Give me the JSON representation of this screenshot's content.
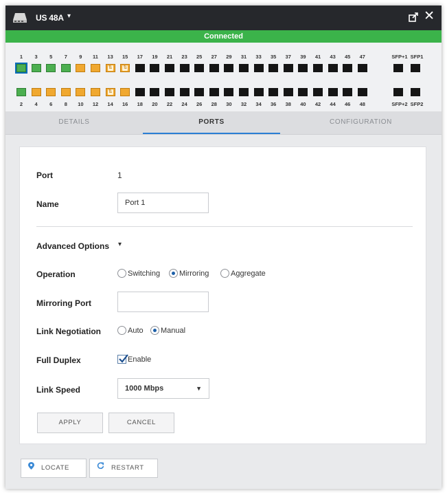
{
  "titlebar": {
    "device": "US 48A",
    "caret": "▾",
    "close": "✕"
  },
  "status": {
    "text": "Connected",
    "color": "#3bb34a"
  },
  "ports": {
    "top_labels": [
      "1",
      "3",
      "5",
      "7",
      "9",
      "11",
      "13",
      "15",
      "17",
      "19",
      "21",
      "23",
      "25",
      "27",
      "29",
      "31",
      "33",
      "35",
      "37",
      "39",
      "41",
      "43",
      "45",
      "47"
    ],
    "bottom_labels": [
      "2",
      "4",
      "6",
      "8",
      "10",
      "12",
      "14",
      "16",
      "18",
      "20",
      "22",
      "24",
      "26",
      "28",
      "30",
      "32",
      "34",
      "36",
      "38",
      "40",
      "42",
      "44",
      "46",
      "48"
    ],
    "top_states": [
      "green",
      "green",
      "green",
      "green",
      "orange",
      "orange",
      "orange-link",
      "orange-link",
      "black",
      "black",
      "black",
      "black",
      "black",
      "black",
      "black",
      "black",
      "black",
      "black",
      "black",
      "black",
      "black",
      "black",
      "black",
      "black"
    ],
    "bottom_states": [
      "green",
      "orange",
      "orange",
      "orange",
      "orange",
      "orange",
      "orange-link",
      "orange",
      "black",
      "black",
      "black",
      "black",
      "black",
      "black",
      "black",
      "black",
      "black",
      "black",
      "black",
      "black",
      "black",
      "black",
      "black",
      "black"
    ],
    "sfp_top_labels": [
      "SFP+1",
      "SFP1"
    ],
    "sfp_bottom_labels": [
      "SFP+2",
      "SFP2"
    ],
    "colors": {
      "green": "#4caf50",
      "orange": "#f0a830",
      "black": "#151515"
    },
    "selected_port": "1"
  },
  "tabs": [
    {
      "label": "DETAILS"
    },
    {
      "label": "PORTS",
      "active": true
    },
    {
      "label": "CONFIGURATION"
    }
  ],
  "form": {
    "port_label": "Port",
    "port_value": "1",
    "name_label": "Name",
    "name_value": "Port 1",
    "advanced_label": "Advanced Options",
    "advanced_caret": "▾",
    "operation_label": "Operation",
    "operation_options": [
      "Switching",
      "Mirroring",
      "Aggregate"
    ],
    "operation_selected": "Mirroring",
    "mirroring_port_label": "Mirroring Port",
    "mirroring_port_value": "",
    "link_negotiation_label": "Link Negotiation",
    "link_negotiation_options": [
      "Auto",
      "Manual"
    ],
    "link_negotiation_selected": "Manual",
    "full_duplex_label": "Full Duplex",
    "full_duplex_option": "Enable",
    "full_duplex_checked": true,
    "link_speed_label": "Link Speed",
    "link_speed_value": "1000 Mbps",
    "apply": "APPLY",
    "cancel": "CANCEL"
  },
  "footer": {
    "locate": "LOCATE",
    "restart": "RESTART"
  }
}
